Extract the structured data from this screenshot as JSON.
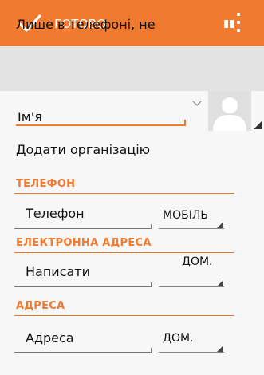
{
  "action_bar": {
    "done_label": "ГОТОВО"
  },
  "account": {
    "label": "Лише в телефоні, не"
  },
  "name": {
    "value": "Ім'я"
  },
  "organization": {
    "add_label": "Додати організацію"
  },
  "phone": {
    "header": "ТЕЛЕФОН",
    "field": "Телефон",
    "type": "МОБІЛЬ"
  },
  "email": {
    "header": "ЕЛЕКТРОННА АДРЕСА",
    "field": "Написати",
    "type": "ДОМ."
  },
  "address": {
    "header": "АДРЕСА",
    "field": "Адреса",
    "type": "ДОМ."
  },
  "colors": {
    "accent": "#f07a30",
    "account_bg": "#e3e3e3",
    "background": "#f7f7f7"
  }
}
